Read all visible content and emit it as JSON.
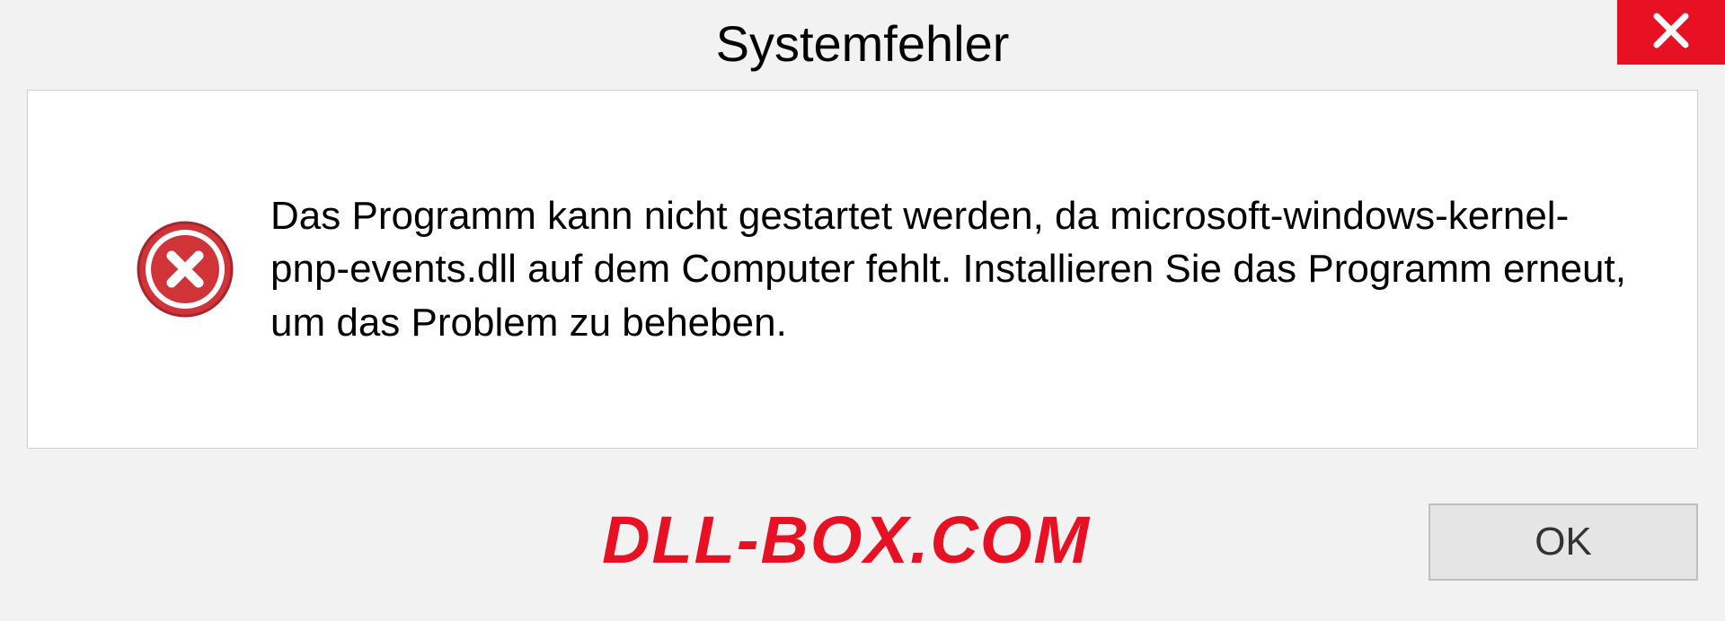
{
  "dialog": {
    "title": "Systemfehler",
    "message": "Das Programm kann nicht gestartet werden, da microsoft-windows-kernel-pnp-events.dll auf dem Computer fehlt. Installieren Sie das Programm erneut, um das Problem zu beheben.",
    "ok_label": "OK"
  },
  "watermark": "DLL-BOX.COM",
  "colors": {
    "accent_red": "#e81123",
    "panel_bg": "#ffffff",
    "dialog_bg": "#f2f2f2"
  }
}
